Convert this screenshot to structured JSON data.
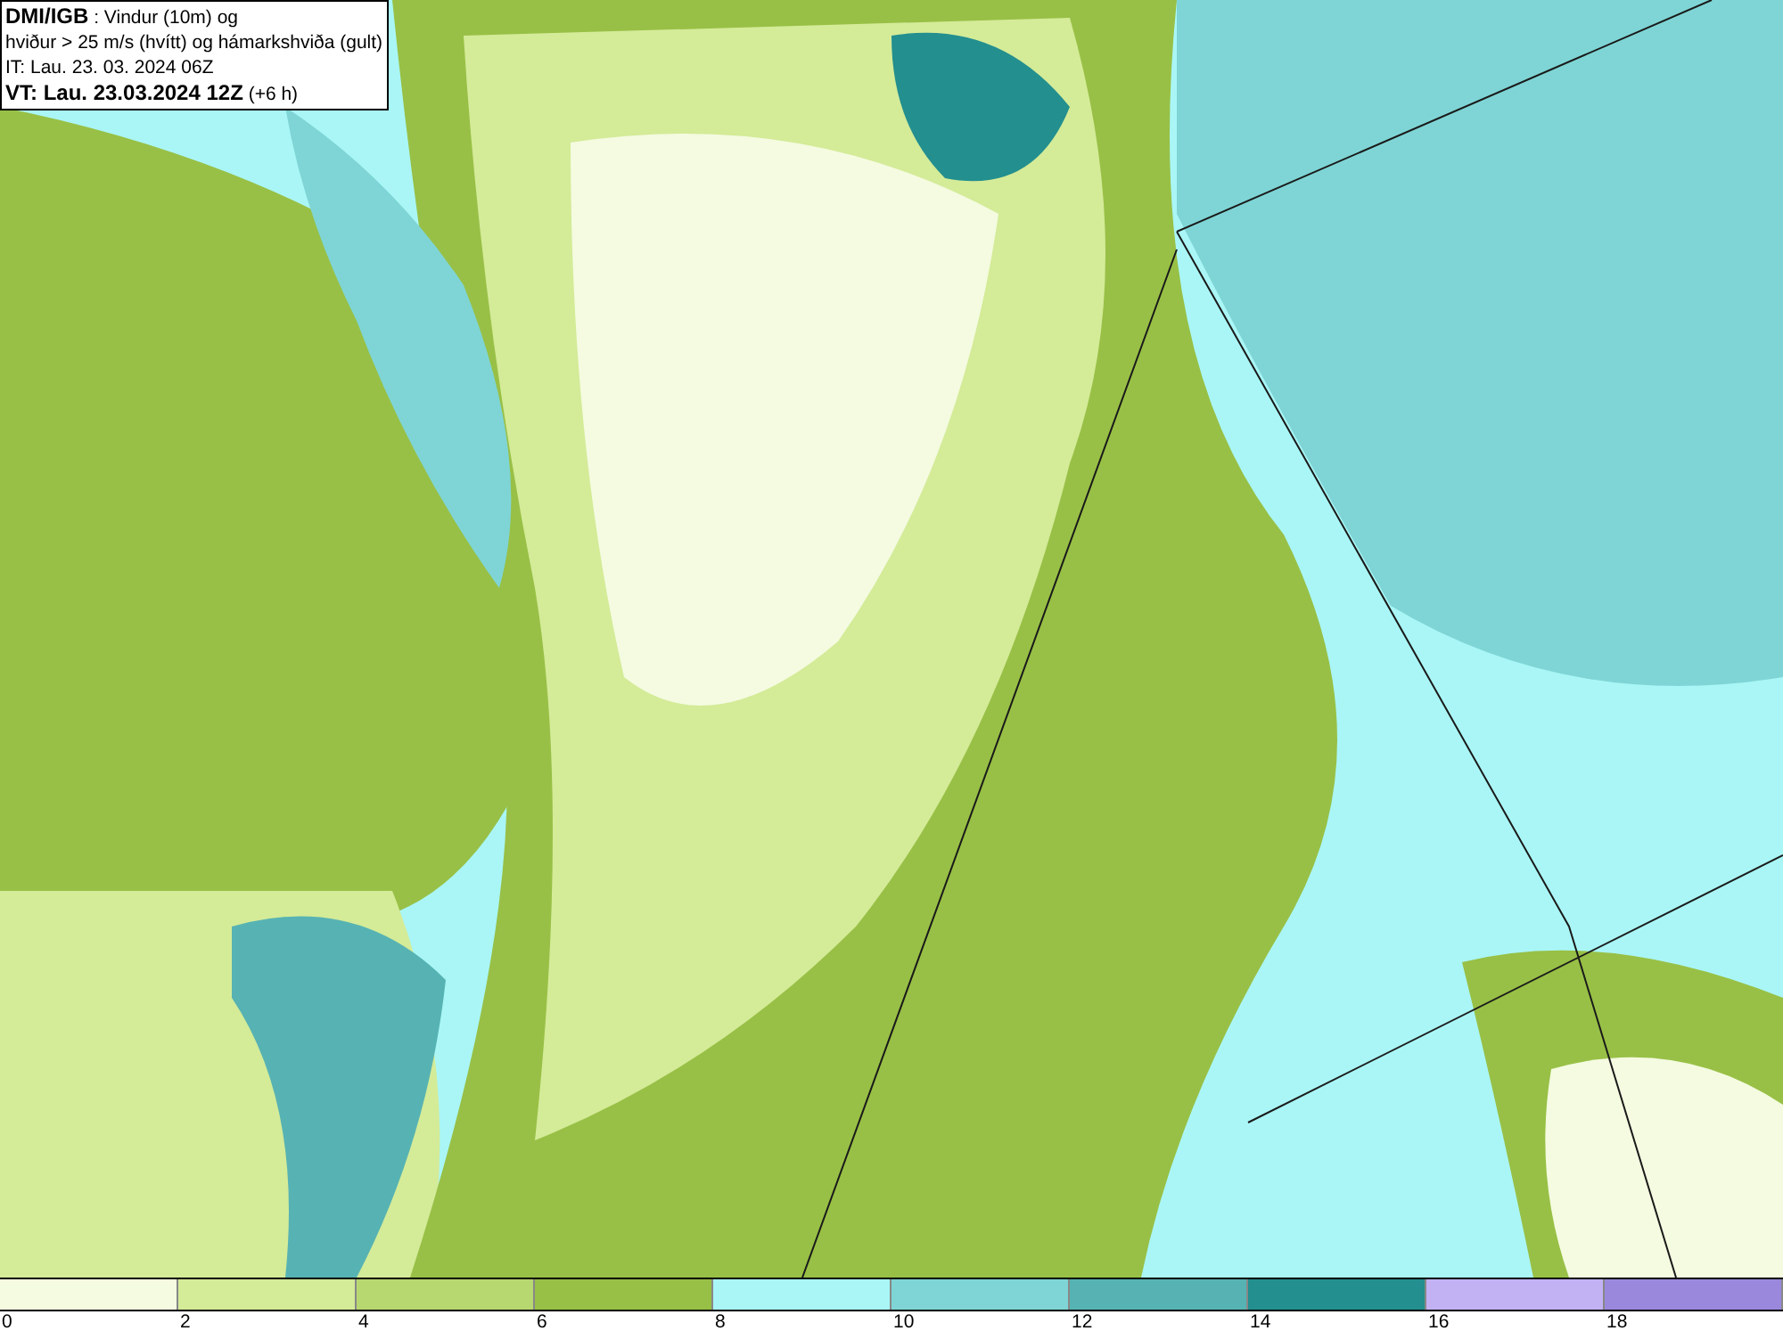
{
  "header": {
    "lines": [
      "**DMI/IGB** : Vindur (10m) og",
      "hviður > 25 m/s (hvítt) og hámarkshviða (gult)",
      "IT: Lau. 23. 03. 2024 06Z",
      "**VT: Lau. 23.03.2024 12Z** (+6 h)"
    ]
  },
  "legend": {
    "bins": [
      {
        "color": "#f4fbe0"
      },
      {
        "color": "#d4eb98"
      },
      {
        "color": "#b7d870"
      },
      {
        "color": "#98c046"
      },
      {
        "color": "#aaf6f6"
      },
      {
        "color": "#7fd5d5"
      },
      {
        "color": "#57b3b3"
      },
      {
        "color": "#238f8f"
      },
      {
        "color": "#c2b2f4"
      },
      {
        "color": "#9a88dd"
      }
    ],
    "ticks": [
      "0",
      "2",
      "4",
      "6",
      "8",
      "10",
      "12",
      "14",
      "16",
      "18"
    ]
  }
}
